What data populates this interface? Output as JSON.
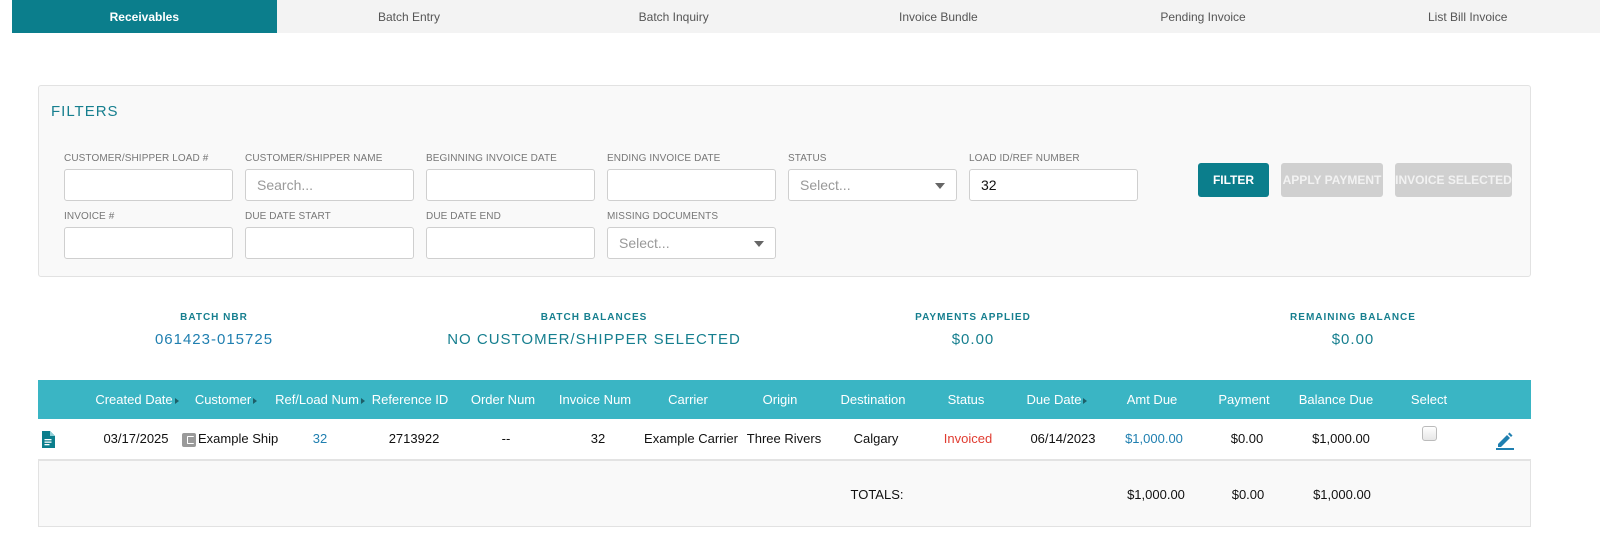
{
  "tabs": [
    {
      "label": "Receivables",
      "active": true
    },
    {
      "label": "Batch Entry",
      "active": false
    },
    {
      "label": "Batch Inquiry",
      "active": false
    },
    {
      "label": "Invoice Bundle",
      "active": false
    },
    {
      "label": "Pending Invoice",
      "active": false
    },
    {
      "label": "List Bill Invoice",
      "active": false
    }
  ],
  "filters": {
    "title": "FILTERS",
    "customer_load": {
      "label": "CUSTOMER/SHIPPER LOAD #",
      "value": ""
    },
    "customer_name": {
      "label": "CUSTOMER/SHIPPER NAME",
      "placeholder": "Search..."
    },
    "begin_date": {
      "label": "BEGINNING INVOICE DATE",
      "value": ""
    },
    "end_date": {
      "label": "ENDING INVOICE DATE",
      "value": ""
    },
    "status": {
      "label": "STATUS",
      "placeholder": "Select..."
    },
    "load_id": {
      "label": "LOAD ID/REF NUMBER",
      "value": "32"
    },
    "invoice_num": {
      "label": "INVOICE #",
      "value": ""
    },
    "due_start": {
      "label": "DUE DATE START",
      "value": ""
    },
    "due_end": {
      "label": "DUE DATE END",
      "value": ""
    },
    "missing_docs": {
      "label": "MISSING DOCUMENTS",
      "placeholder": "Select..."
    },
    "buttons": {
      "filter": "FILTER",
      "apply_payment": "APPLY PAYMENT",
      "invoice_selected": "INVOICE SELECTED"
    }
  },
  "summary": {
    "batch_nbr": {
      "label": "BATCH NBR",
      "value": "061423-015725"
    },
    "batch_balances": {
      "label": "BATCH BALANCES",
      "value": "NO CUSTOMER/SHIPPER SELECTED"
    },
    "payments_applied": {
      "label": "PAYMENTS APPLIED",
      "value": "$0.00"
    },
    "remaining_balance": {
      "label": "REMAINING BALANCE",
      "value": "$0.00"
    }
  },
  "table": {
    "headers": {
      "created": "Created Date",
      "customer": "Customer",
      "ref_load": "Ref/Load Num",
      "reference_id": "Reference ID",
      "order_num": "Order Num",
      "invoice_num": "Invoice Num",
      "carrier": "Carrier",
      "origin": "Origin",
      "destination": "Destination",
      "status": "Status",
      "due_date": "Due Date",
      "amt_due": "Amt Due",
      "payment": "Payment",
      "balance_due": "Balance Due",
      "select": "Select"
    },
    "rows": [
      {
        "created": "03/17/2025",
        "customer": "Example Ship",
        "ref_load": "32",
        "reference_id": "2713922",
        "order_num": "--",
        "invoice_num": "32",
        "carrier": "Example Carrier",
        "origin": "Three Rivers",
        "destination": "Calgary",
        "status": "Invoiced",
        "due_date": "06/14/2023",
        "amt_due": "$1,000.00",
        "payment": "$0.00",
        "balance_due": "$1,000.00",
        "selected": false
      }
    ],
    "totals": {
      "label": "TOTALS:",
      "amt_due": "$1,000.00",
      "payment": "$0.00",
      "balance_due": "$1,000.00"
    }
  },
  "colors": {
    "accent": "#0b7e8c",
    "header": "#3ab5c4",
    "status_invoiced": "#e03c31",
    "link": "#1f7fb0"
  },
  "icons": {
    "row_doc": "document-icon",
    "customer": "customer-card-icon",
    "edit": "pencil-edit-icon",
    "sort": "sort-caret-icon"
  }
}
